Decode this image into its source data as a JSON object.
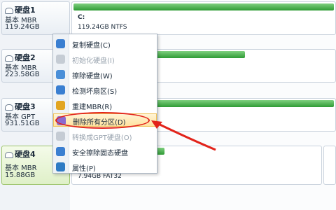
{
  "disks": [
    {
      "title": "硬盘1",
      "type": "基本 MBR",
      "size": "119.24GB",
      "partition": {
        "letter": "C:",
        "info": "119.24GB NTFS"
      }
    },
    {
      "title": "硬盘2",
      "type": "基本 MBR",
      "size": "223.58GB"
    },
    {
      "title": "硬盘3",
      "type": "基本 GPT",
      "size": "931.51GB"
    },
    {
      "title": "硬盘4",
      "type": "基本 MBR",
      "size": "15.88GB",
      "partition": {
        "info": "7.94GB FAT32"
      }
    }
  ],
  "menu": {
    "items": [
      {
        "label": "复制硬盘(C)",
        "enabled": true
      },
      {
        "label": "初始化硬盘(I)",
        "enabled": false
      },
      {
        "label": "擦除硬盘(W)",
        "enabled": true
      },
      {
        "label": "检测坏扇区(S)",
        "enabled": true
      },
      {
        "label": "重建MBR(R)",
        "enabled": true
      },
      {
        "label": "删除所有分区(D)",
        "enabled": true,
        "highlighted": true
      },
      {
        "label": "转换成GPT硬盘(O)",
        "enabled": false
      },
      {
        "label": "安全擦除固态硬盘",
        "enabled": true
      },
      {
        "label": "属性(P)",
        "enabled": true
      }
    ]
  },
  "colors": {
    "bar_green": "#2f9b35",
    "highlight": "#ffe3a0",
    "annotation_red": "#e2231a"
  },
  "icons": [
    "copy-disk-icon",
    "init-disk-icon",
    "wipe-disk-icon",
    "check-sector-icon",
    "rebuild-mbr-icon",
    "delete-partition-icon",
    "convert-gpt-icon",
    "secure-erase-icon",
    "properties-icon"
  ]
}
